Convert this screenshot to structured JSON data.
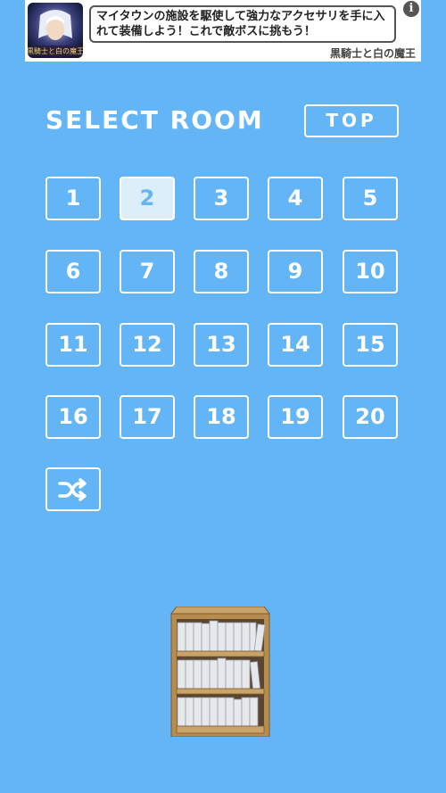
{
  "ad": {
    "text": "マイタウンの施設を駆使して強力なアクセサリを手に入れて装備しよう！これで敵ボスに挑もう！",
    "brand": "黒騎士と白の魔王",
    "info_icon": "i"
  },
  "title": "SELECT ROOM",
  "top_label": "TOP",
  "rooms": [
    "1",
    "2",
    "3",
    "4",
    "5",
    "6",
    "7",
    "8",
    "9",
    "10",
    "11",
    "12",
    "13",
    "14",
    "15",
    "16",
    "17",
    "18",
    "19",
    "20"
  ],
  "selected_room": "2",
  "shuffle_icon": "shuffle-icon",
  "colors": {
    "background": "#64b5f6",
    "selected_fill": "#ddeefb",
    "border": "#ffffff"
  }
}
